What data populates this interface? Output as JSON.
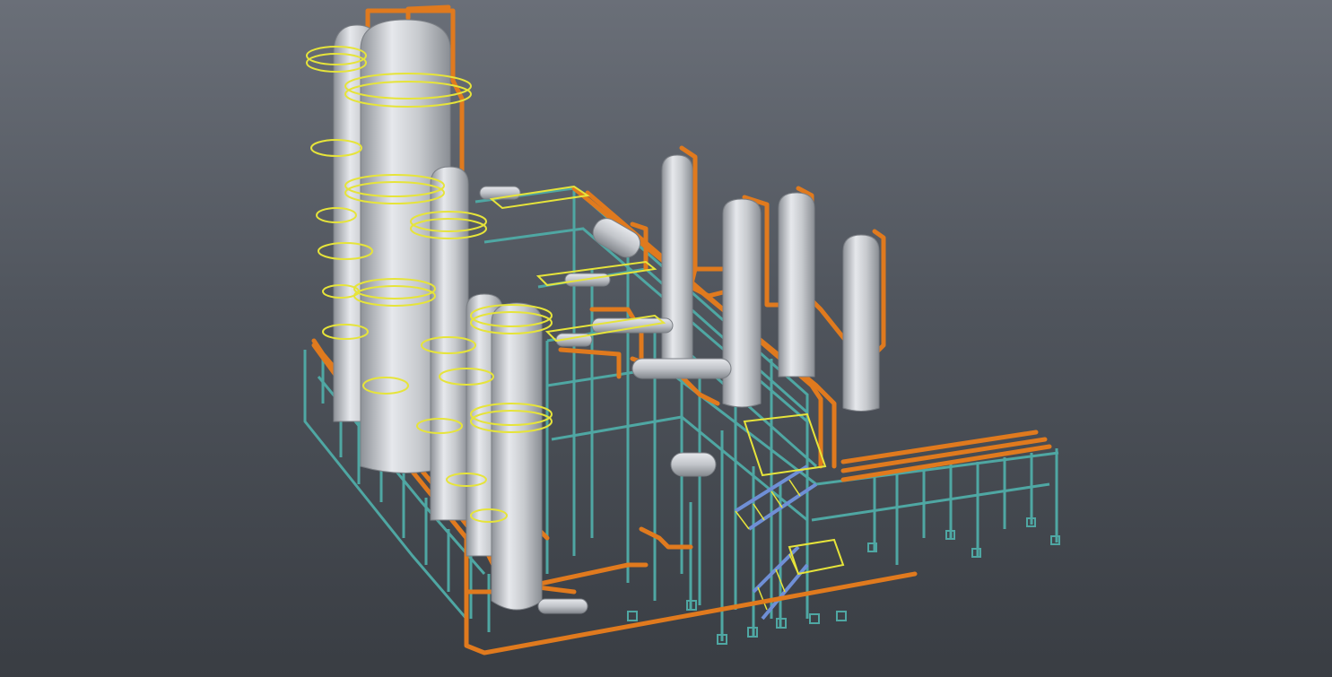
{
  "viewport": {
    "background_top": "#6a6f78",
    "background_bottom": "#393d43"
  },
  "model": {
    "vessel_color": "#c9ccd1",
    "pipe_color": "#e07a1e",
    "structure_color": "#4fa7a3",
    "platform_color": "#e6e43a",
    "stair_color": "#6f8fd6"
  }
}
